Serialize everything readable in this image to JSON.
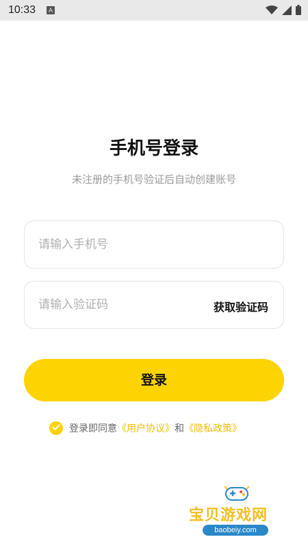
{
  "status_bar": {
    "time": "10:33",
    "notification_badge": "A",
    "icons": [
      "wifi-icon",
      "signal-icon",
      "battery-icon"
    ]
  },
  "login": {
    "title": "手机号登录",
    "subtitle": "未注册的手机号验证后自动创建账号",
    "phone_placeholder": "请输入手机号",
    "phone_value": "",
    "code_placeholder": "请输入验证码",
    "code_value": "",
    "get_code_label": "获取验证码",
    "login_button_label": "登录"
  },
  "agreement": {
    "checked": true,
    "prefix": "登录即同意",
    "user_agreement_link": "《用户协议》",
    "conjunction": "和",
    "privacy_policy_link": "《隐私政策》"
  },
  "watermark": {
    "text": "宝贝游戏网",
    "domain": "baobeiy.com"
  },
  "colors": {
    "accent": "#fdd400",
    "link": "#f0c000",
    "subtitle": "#9a9a9a",
    "status_bar": "#e9e9e9"
  }
}
